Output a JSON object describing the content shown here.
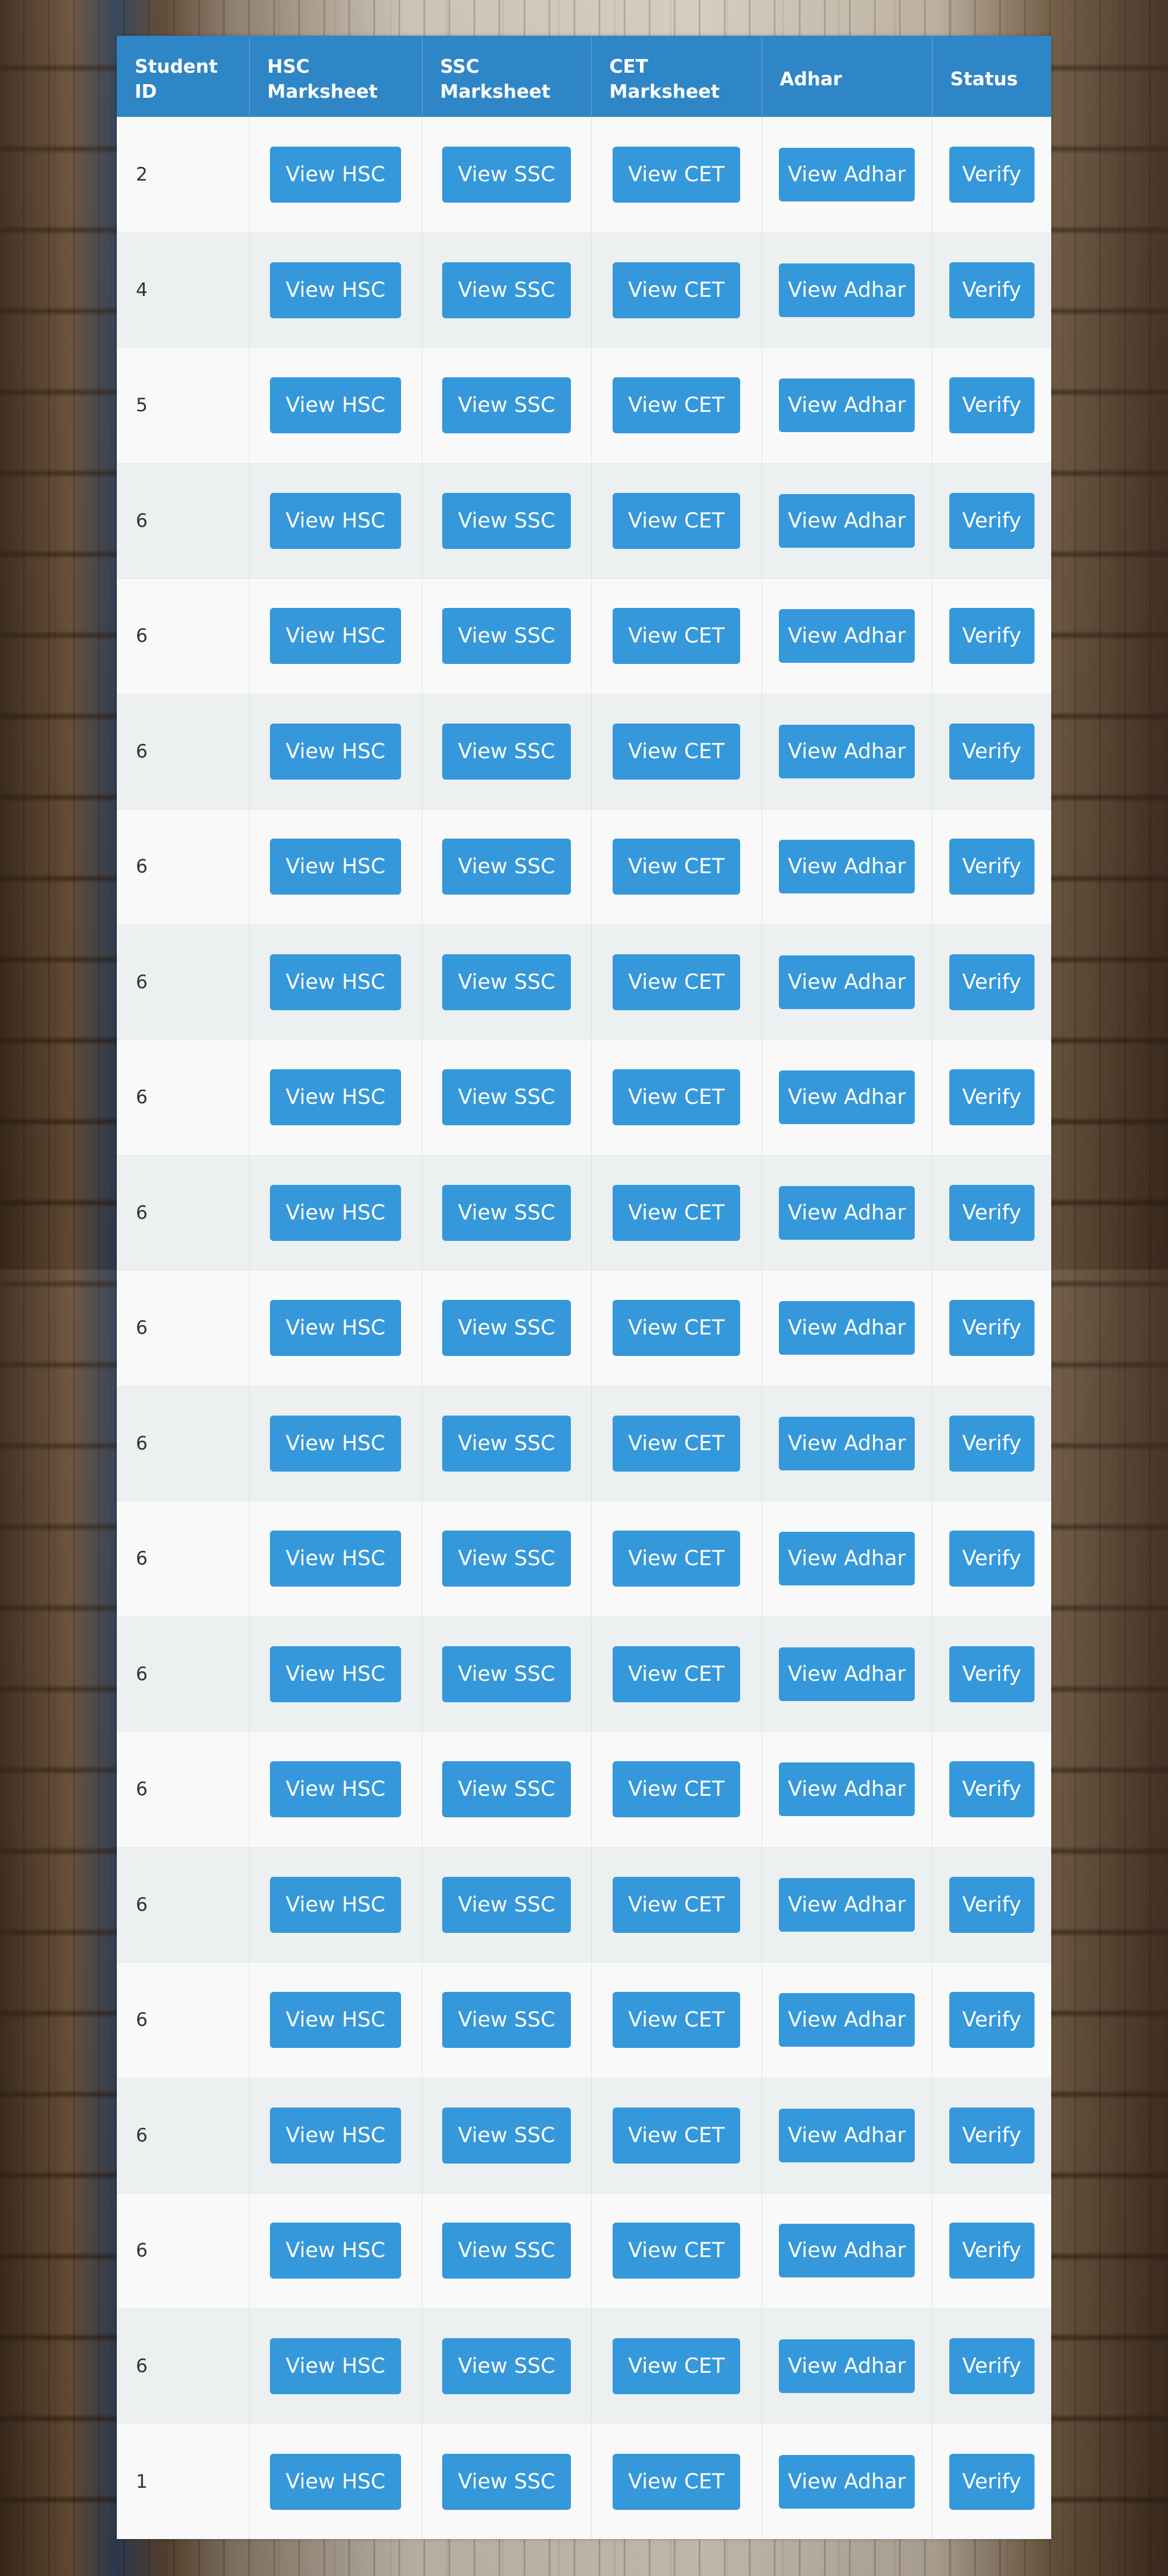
{
  "table": {
    "headers": {
      "student_id": "Student ID",
      "hsc": "HSC Marksheet",
      "ssc": "SSC Marksheet",
      "cet": "CET Marksheet",
      "adhar": "Adhar",
      "status": "Status"
    },
    "buttons": {
      "hsc": "View HSC",
      "ssc": "View SSC",
      "cet": "View CET",
      "adhar": "View Adhar",
      "verify": "Verify"
    },
    "rows": [
      {
        "id": "2"
      },
      {
        "id": "4"
      },
      {
        "id": "5"
      },
      {
        "id": "6"
      },
      {
        "id": "6"
      },
      {
        "id": "6"
      },
      {
        "id": "6"
      },
      {
        "id": "6"
      },
      {
        "id": "6"
      },
      {
        "id": "6"
      },
      {
        "id": "6"
      },
      {
        "id": "6"
      },
      {
        "id": "6"
      },
      {
        "id": "6"
      },
      {
        "id": "6"
      },
      {
        "id": "6"
      },
      {
        "id": "6"
      },
      {
        "id": "6"
      },
      {
        "id": "6"
      },
      {
        "id": "6"
      },
      {
        "id": "1"
      }
    ]
  },
  "colors": {
    "header_bg": "#2f86c6",
    "button_bg": "#3498db",
    "row_odd": "#f9f9f9",
    "row_even": "#ecf0f1"
  },
  "background": {
    "image": "library-bookshelves-image"
  }
}
